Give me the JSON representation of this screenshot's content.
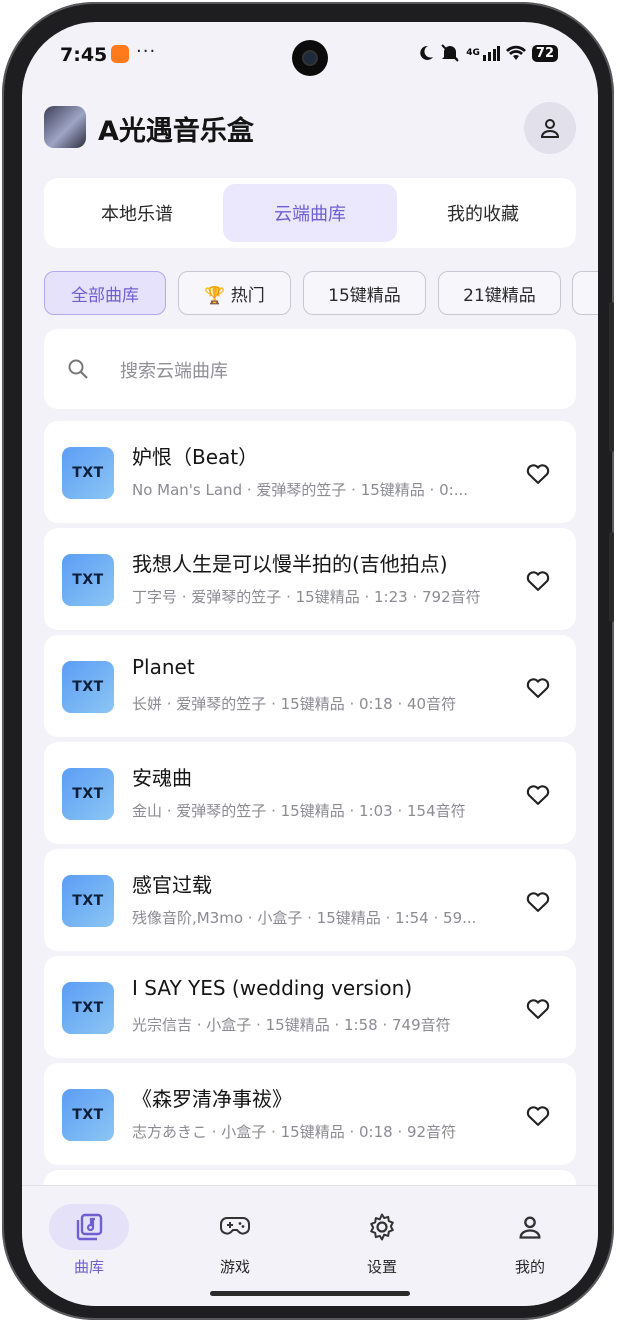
{
  "status_bar": {
    "time": "7:45",
    "more": "···",
    "network": "4G",
    "battery": "72"
  },
  "header": {
    "app_title": "A光遇音乐盒",
    "avatar_icon": "app-avatar-image",
    "profile_icon": "user-icon"
  },
  "source_tabs": [
    {
      "label": "本地乐谱",
      "active": false
    },
    {
      "label": "云端曲库",
      "active": true
    },
    {
      "label": "我的收藏",
      "active": false
    }
  ],
  "filter_chips": [
    {
      "label": "全部曲库",
      "active": true
    },
    {
      "label": "🏆 热门",
      "active": false
    },
    {
      "label": "15键精品",
      "active": false
    },
    {
      "label": "21键精品",
      "active": false
    }
  ],
  "search": {
    "placeholder": "搜索云端曲库"
  },
  "songs": [
    {
      "badge": "TXT",
      "title": "妒恨（Beat）",
      "meta": "No Man's Land · 爱弹琴的笠子 · 15键精品 · 0:..."
    },
    {
      "badge": "TXT",
      "title": "我想人生是可以慢半拍的(吉他拍点)",
      "meta": "丁字号 · 爱弹琴的笠子 · 15键精品 · 1:23 · 792音符"
    },
    {
      "badge": "TXT",
      "title": "Planet",
      "meta": "长姘 · 爱弹琴的笠子 · 15键精品 · 0:18 · 40音符"
    },
    {
      "badge": "TXT",
      "title": "安魂曲",
      "meta": "金山 · 爱弹琴的笠子 · 15键精品 · 1:03 · 154音符"
    },
    {
      "badge": "TXT",
      "title": "感官过载",
      "meta": "残像音阶,M3mo · 小盒子 · 15键精品 · 1:54 · 59..."
    },
    {
      "badge": "TXT",
      "title": "I SAY YES (wedding version)",
      "meta": "光宗信吉 · 小盒子 · 15键精品 · 1:58 · 749音符"
    },
    {
      "badge": "TXT",
      "title": "《森罗清净事祓》",
      "meta": "志方あきこ · 小盒子 · 15键精品 · 0:18 · 92音符"
    }
  ],
  "bottom_nav": [
    {
      "label": "曲库",
      "icon": "music-library-icon",
      "active": true
    },
    {
      "label": "游戏",
      "icon": "gamepad-icon",
      "active": false
    },
    {
      "label": "设置",
      "icon": "gear-icon",
      "active": false
    },
    {
      "label": "我的",
      "icon": "user-icon",
      "active": false
    }
  ],
  "colors": {
    "accent": "#6f5fd0",
    "accent_bg": "#ebe8fd",
    "background": "#f3f2f8"
  }
}
